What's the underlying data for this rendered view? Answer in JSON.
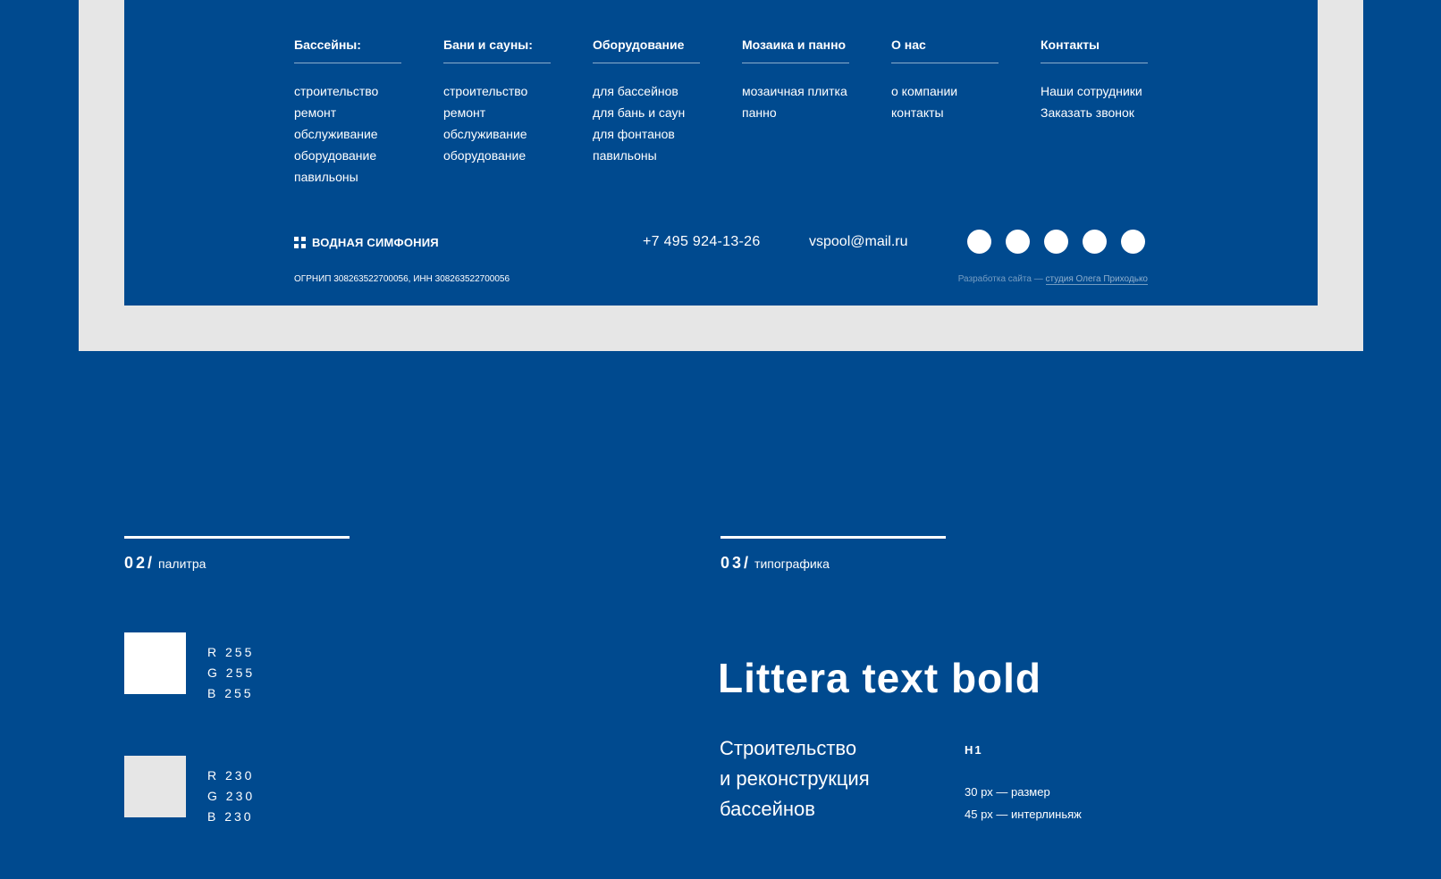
{
  "footer": {
    "columns": [
      {
        "title": "Бассейны:",
        "items": [
          "строительство",
          "ремонт",
          "обслуживание",
          "оборудование",
          "павильоны"
        ]
      },
      {
        "title": "Бани и сауны:",
        "items": [
          "строительство",
          "ремонт",
          "обслуживание",
          "оборудование"
        ]
      },
      {
        "title": "Оборудование",
        "items": [
          "для бассейнов",
          "для бань и саун",
          "для фонтанов",
          "павильоны"
        ]
      },
      {
        "title": "Мозаика и панно",
        "items": [
          "мозаичная плитка",
          "панно"
        ]
      },
      {
        "title": "О нас",
        "items": [
          "о компании",
          "контакты"
        ]
      },
      {
        "title": "Контакты",
        "items": [
          "Наши сотрудники",
          "Заказать звонок"
        ]
      }
    ],
    "logo_text": "ВОДНАЯ СИМФОНИЯ",
    "phone": "+7  495  924-13-26",
    "email": "vspool@mail.ru",
    "social_icons": [
      "social-circle-icon",
      "social-circle-icon",
      "social-circle-icon",
      "social-circle-icon",
      "social-circle-icon"
    ],
    "legal": "ОГРНИП 308263522700056, ИНН 308263522700056",
    "dev_prefix": "Разработка сайта —",
    "dev_link": "студия Олега Приходько"
  },
  "palette_section": {
    "number": "02",
    "slash": "/",
    "label": "палитра",
    "swatches": [
      {
        "color": "#ffffff",
        "r": "R 255",
        "g": "G 255",
        "b": "B 255"
      },
      {
        "color": "#e6e6e6",
        "r": "R 230",
        "g": "G 230",
        "b": "B 230"
      }
    ]
  },
  "typography_section": {
    "number": "03",
    "slash": "/",
    "label": "типографика",
    "font_name": "Littera text bold",
    "sample_lines": [
      "Строительство",
      "и реконструкция",
      "бассейнов"
    ],
    "tag": "H1",
    "size_line": "30 px  —  размер",
    "leading_line": "45 px  —  интерлиньяж"
  },
  "colors": {
    "background": "#004a8f",
    "frame": "#e6e6e6",
    "text": "#ffffff"
  }
}
